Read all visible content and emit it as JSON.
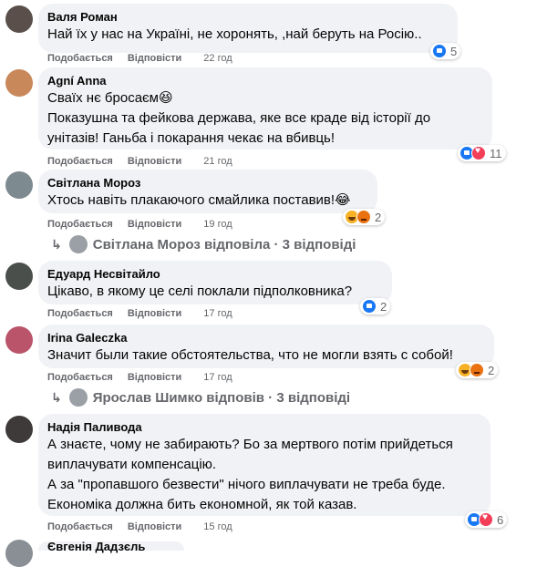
{
  "actions": {
    "like": "Подобається",
    "reply": "Відповісти"
  },
  "comments": [
    {
      "author": "Валя Роман",
      "text": "Най їх у нас на Україні, не хоронять, ,най беруть на Росію..",
      "time": "22 год",
      "reactions": [
        "like"
      ],
      "reaction_count": "5"
    },
    {
      "author": "Agní Anna",
      "text": "Сваїх нє бросаєм😆\nПоказушна та фейкова держава, яке все краде від історії до унітазів! Ганьба і покарання чекає на вбивць!",
      "time": "21 год",
      "reactions": [
        "like",
        "love"
      ],
      "reaction_count": "11"
    },
    {
      "author": "Світлана Мороз",
      "text": "Хтось навіть плакаючого смайлика поставив!😂",
      "time": "19 год",
      "reactions": [
        "haha",
        "angry"
      ],
      "reaction_count": "2",
      "replies": "Світлана Мороз відповіла · 3 відповіді"
    },
    {
      "author": "Едуард Несвітайло",
      "text": "Цікаво, в якому це селі поклали підполковника?",
      "time": "17 год",
      "reactions": [
        "like"
      ],
      "reaction_count": "2"
    },
    {
      "author": "Irina Galeczka",
      "text": "Значит были такие обстоятельства, что не могли взять с собой!",
      "time": "17 год",
      "reactions": [
        "haha",
        "angry"
      ],
      "reaction_count": "2",
      "replies": "Ярослав Шимко відповів · 3 відповіді"
    },
    {
      "author": "Надія Паливода",
      "text": "А знаєте, чому не забирають? Бо за мертвого потім прийдеться виплачувати компенсацію.\nА за \"пропавшого безвести\" нічого виплачувати не треба буде.\nЕкономіка должна бить економной, як той казав.",
      "time": "15 год",
      "reactions": [
        "like",
        "love"
      ],
      "reaction_count": "6"
    }
  ],
  "partial_author": "Євгенія Дадзєль",
  "colors": {
    "bubble": "#f0f2f5",
    "secondary_text": "#65676b",
    "like": "#1877f2",
    "love": "#f33e58"
  }
}
